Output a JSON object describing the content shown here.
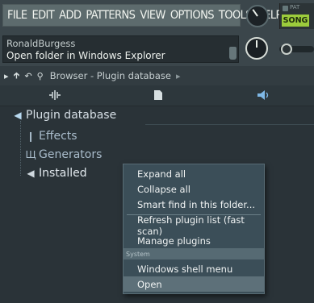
{
  "menubar": {
    "items": [
      "FILE",
      "EDIT",
      "ADD",
      "PATTERNS",
      "VIEW",
      "OPTIONS",
      "TOOLS",
      "HELP"
    ],
    "pat_label": "PAT",
    "song_label": "SONG"
  },
  "hint": {
    "title": "RonaldBurgess",
    "text": "Open folder in Windows Explorer"
  },
  "browser": {
    "title": "Browser - Plugin database",
    "tree": {
      "root": "Plugin database",
      "effects": "Effects",
      "generators": "Generators",
      "installed": "Installed"
    }
  },
  "context_menu": {
    "items": [
      {
        "label": "Expand all"
      },
      {
        "label": "Collapse all"
      },
      {
        "label": "Smart find in this folder..."
      },
      {
        "label": "Refresh plugin list (fast scan)"
      },
      {
        "label": "Manage plugins"
      }
    ],
    "section": "System",
    "system_items": [
      {
        "label": "Windows shell menu"
      },
      {
        "label": "Open"
      }
    ]
  },
  "colors": {
    "song_active": "#9ccc3c",
    "menu_bg": "#5d6b6d",
    "context_bg": "#3b4e58",
    "highlight": "#5d7079"
  }
}
